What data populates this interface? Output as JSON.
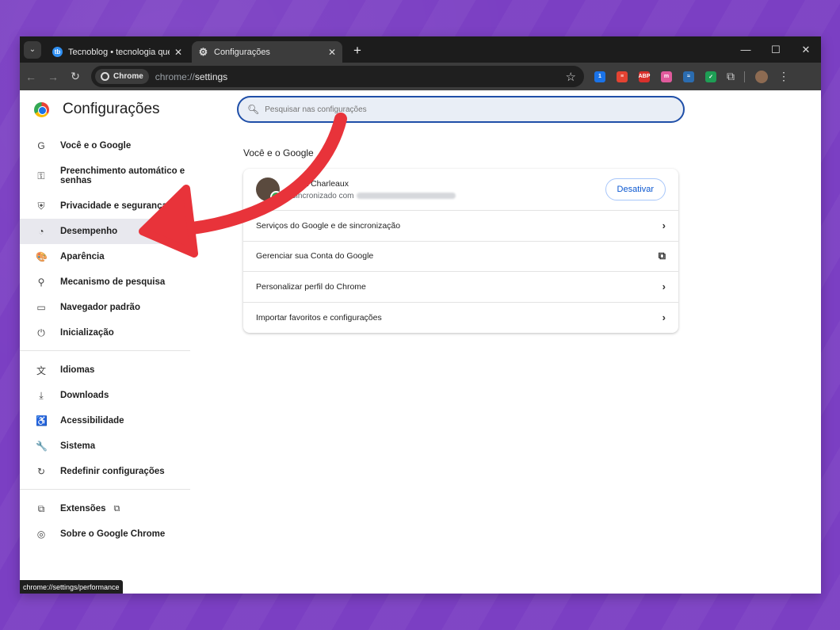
{
  "tabs": [
    {
      "title": "Tecnoblog • tecnologia que inte",
      "favicon": "tb",
      "active": false
    },
    {
      "title": "Configurações",
      "favicon": "gear-icon",
      "active": true
    }
  ],
  "toolbar": {
    "chip_label": "Chrome",
    "url_prefix": "chrome://",
    "url_host": "settings"
  },
  "extensions": [
    {
      "name": "1password-icon",
      "label": "1",
      "color": "#1a73e8"
    },
    {
      "name": "todoist-icon",
      "label": "≡",
      "color": "#e44332"
    },
    {
      "name": "adblock-icon",
      "label": "ABP",
      "color": "#d9302c"
    },
    {
      "name": "extension-m-icon",
      "label": "m",
      "color": "#e05a9c"
    },
    {
      "name": "extension-lines-icon",
      "label": "≈",
      "color": "#2b6cb0"
    },
    {
      "name": "extension-shield-icon",
      "label": "✓",
      "color": "#1e9e55"
    }
  ],
  "sidebar": {
    "title": "Configurações",
    "items": [
      {
        "name": "you-and-google",
        "label": "Você e o Google",
        "icon": "G"
      },
      {
        "name": "autofill",
        "label": "Preenchimento automático e senhas",
        "icon": "⚿"
      },
      {
        "name": "privacy",
        "label": "Privacidade e segurança",
        "icon": "⛨"
      },
      {
        "name": "performance",
        "label": "Desempenho",
        "icon": "◔"
      },
      {
        "name": "appearance",
        "label": "Aparência",
        "icon": "🎨"
      },
      {
        "name": "search-engine",
        "label": "Mecanismo de pesquisa",
        "icon": "⚲"
      },
      {
        "name": "default-browser",
        "label": "Navegador padrão",
        "icon": "▭"
      },
      {
        "name": "on-startup",
        "label": "Inicialização",
        "icon": "⏻"
      },
      {
        "name": "languages",
        "label": "Idiomas",
        "icon": "文"
      },
      {
        "name": "downloads",
        "label": "Downloads",
        "icon": "⤓"
      },
      {
        "name": "accessibility",
        "label": "Acessibilidade",
        "icon": "♿"
      },
      {
        "name": "system",
        "label": "Sistema",
        "icon": "🔧"
      },
      {
        "name": "reset",
        "label": "Redefinir configurações",
        "icon": "↻"
      },
      {
        "name": "extensions",
        "label": "Extensões",
        "icon": "⧉"
      },
      {
        "name": "about",
        "label": "Sobre o Google Chrome",
        "icon": "◎"
      }
    ]
  },
  "search": {
    "placeholder": "Pesquisar nas configurações"
  },
  "main": {
    "section_title": "Você e o Google",
    "profile": {
      "name": "…pa Charleaux",
      "sync_text": "Sincronizado com",
      "turn_off_label": "Desativar"
    },
    "rows": [
      {
        "label": "Serviços do Google e de sincronização",
        "icon": "›"
      },
      {
        "label": "Gerenciar sua Conta do Google",
        "icon": "⧉"
      },
      {
        "label": "Personalizar perfil do Chrome",
        "icon": "›"
      },
      {
        "label": "Importar favoritos e configurações",
        "icon": "›"
      }
    ]
  },
  "status_bar": "chrome://settings/performance",
  "colors": {
    "background": "#7b3fc3",
    "accent": "#0b57d0",
    "arrow": "#e8333a"
  }
}
